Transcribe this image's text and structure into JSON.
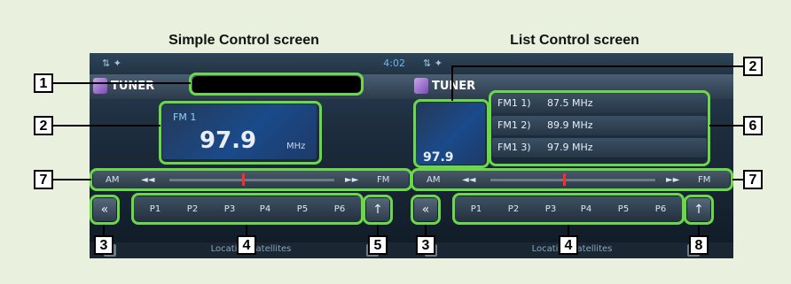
{
  "headings": {
    "simple": "Simple Control screen",
    "list": "List Control screen"
  },
  "status": {
    "clock": "4:02",
    "icons": "⇅ ✦"
  },
  "app": {
    "title": "TUNER"
  },
  "simple": {
    "band": "FM 1",
    "frequency": "97.9",
    "unit": "MHz"
  },
  "list": {
    "frequency_partial": "97.9",
    "presets": [
      {
        "name": "FM1 1)",
        "freq": "87.5  MHz"
      },
      {
        "name": "FM1 2)",
        "freq": "89.9  MHz"
      },
      {
        "name": "FM1 3)",
        "freq": "97.9  MHz"
      }
    ]
  },
  "tuner_bar": {
    "am": "AM",
    "fm": "FM",
    "seek_back": "◄◄",
    "seek_forward": "►►"
  },
  "presets": [
    "P1",
    "P2",
    "P3",
    "P4",
    "P5",
    "P6"
  ],
  "controls": {
    "collapse": "«",
    "antenna": "↑"
  },
  "message": "Locating satellites",
  "callouts": {
    "c1": "1",
    "c2": "2",
    "c3": "3",
    "c4": "4",
    "c5": "5",
    "c6": "6",
    "c7": "7",
    "c8": "8"
  },
  "colors": {
    "highlight": "#6bd84a",
    "background": "#e9f0de",
    "needle": "#ff2a2a"
  }
}
